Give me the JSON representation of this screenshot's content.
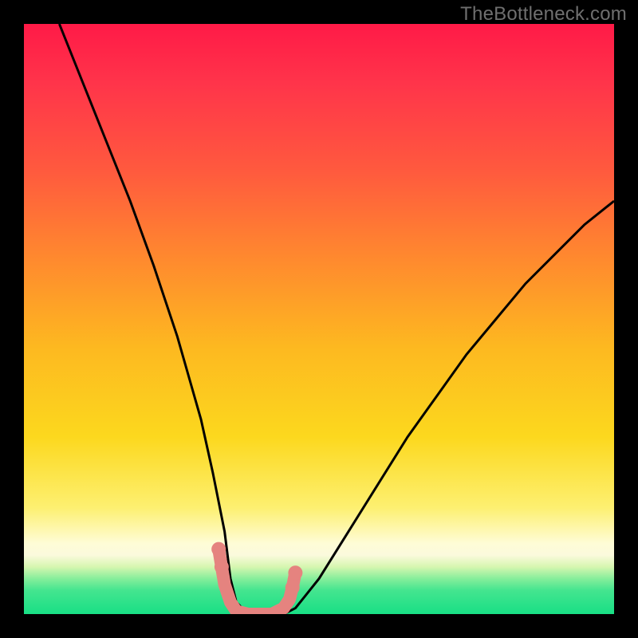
{
  "watermark": {
    "text": "TheBottleneck.com"
  },
  "gradient": {
    "top": "#ff1a47",
    "mid1": "#ff8a2e",
    "mid2": "#fcd81e",
    "pale": "#fefcd6",
    "green": "#18df85"
  },
  "chart_data": {
    "type": "line",
    "title": "",
    "xlabel": "",
    "ylabel": "",
    "xlim": [
      0,
      100
    ],
    "ylim": [
      0,
      100
    ],
    "grid": false,
    "axes_visible": false,
    "series": [
      {
        "name": "bottleneck-curve",
        "color": "#000000",
        "x": [
          6,
          10,
          14,
          18,
          22,
          26,
          28,
          30,
          32,
          34,
          35,
          36,
          38,
          40,
          42,
          44,
          46,
          50,
          55,
          60,
          65,
          70,
          75,
          80,
          85,
          90,
          95,
          100
        ],
        "y": [
          100,
          90,
          80,
          70,
          59,
          47,
          40,
          33,
          24,
          14,
          6,
          2,
          0,
          0,
          0,
          0,
          1,
          6,
          14,
          22,
          30,
          37,
          44,
          50,
          56,
          61,
          66,
          70
        ]
      },
      {
        "name": "optimal-band-marker",
        "color": "#e5837f",
        "x": [
          33.0,
          33.5,
          34.0,
          35.0,
          36.0,
          38.0,
          40.0,
          42.0,
          43.0,
          44.0,
          45.0,
          45.5,
          46.0
        ],
        "y": [
          11.0,
          8.0,
          5.0,
          2.0,
          0.5,
          0.0,
          0.0,
          0.0,
          0.5,
          1.0,
          2.5,
          4.5,
          7.0
        ]
      }
    ],
    "notes": "x and y are in percent of the visible plot area (0 at left/bottom, 100 at right/top). No numeric tick labels are shown in the image; values are estimated from curve geometry relative to the gradient background."
  }
}
